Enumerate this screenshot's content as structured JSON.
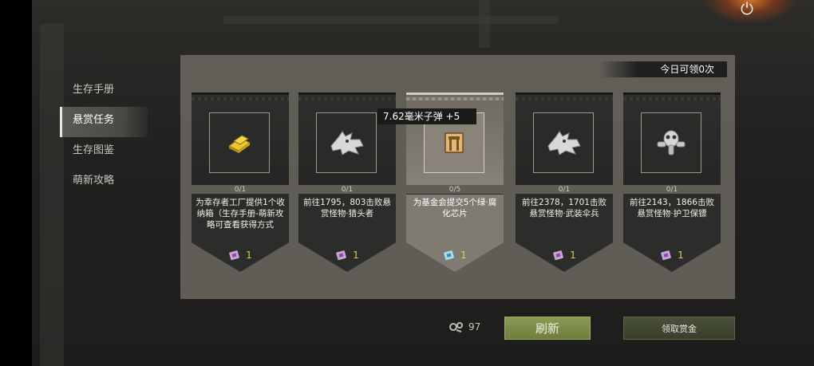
{
  "header": {
    "power_icon": "power-icon",
    "power_glyph": "⏻"
  },
  "sidebar": {
    "items": [
      {
        "label": "生存手册",
        "active": false
      },
      {
        "label": "悬赏任务",
        "active": true
      },
      {
        "label": "生存图鉴",
        "active": false
      },
      {
        "label": "萌新攻略",
        "active": false
      }
    ]
  },
  "bounty": {
    "daily_label": "今日可领0次",
    "tooltip": "7.62毫米子弹   +5",
    "cards": [
      {
        "progress": "0/1",
        "description": "为幸存者工厂提供1个收纳箱（生存手册-萌新攻略可查看获得方式",
        "reward_count": "1",
        "icon": "gold-bars-icon",
        "active": false
      },
      {
        "progress": "0/1",
        "description": "前往1795，803击败悬赏怪物·猎头者",
        "reward_count": "1",
        "icon": "wolf-head-icon",
        "active": false
      },
      {
        "progress": "0/5",
        "description": "为基金会提交5个绿·腐化芯片",
        "reward_count": "1",
        "icon": "chip-icon",
        "active": true
      },
      {
        "progress": "0/1",
        "description": "前往2378，1701击败悬赏怪物·武装伞兵",
        "reward_count": "1",
        "icon": "wolf-head-icon",
        "active": false
      },
      {
        "progress": "0/1",
        "description": "前往2143，1866击败悬赏怪物·护卫保镖",
        "reward_count": "1",
        "icon": "gasmask-icon",
        "active": false
      }
    ]
  },
  "footer": {
    "currency_value": "97",
    "currency_icon": "gear-parts-icon",
    "refresh_label": "刷新",
    "claim_label": "领取赏金"
  },
  "colors": {
    "refresh_button": "#7c8a48",
    "reward_count": "#e6c45a",
    "active_card": "#86827a"
  }
}
